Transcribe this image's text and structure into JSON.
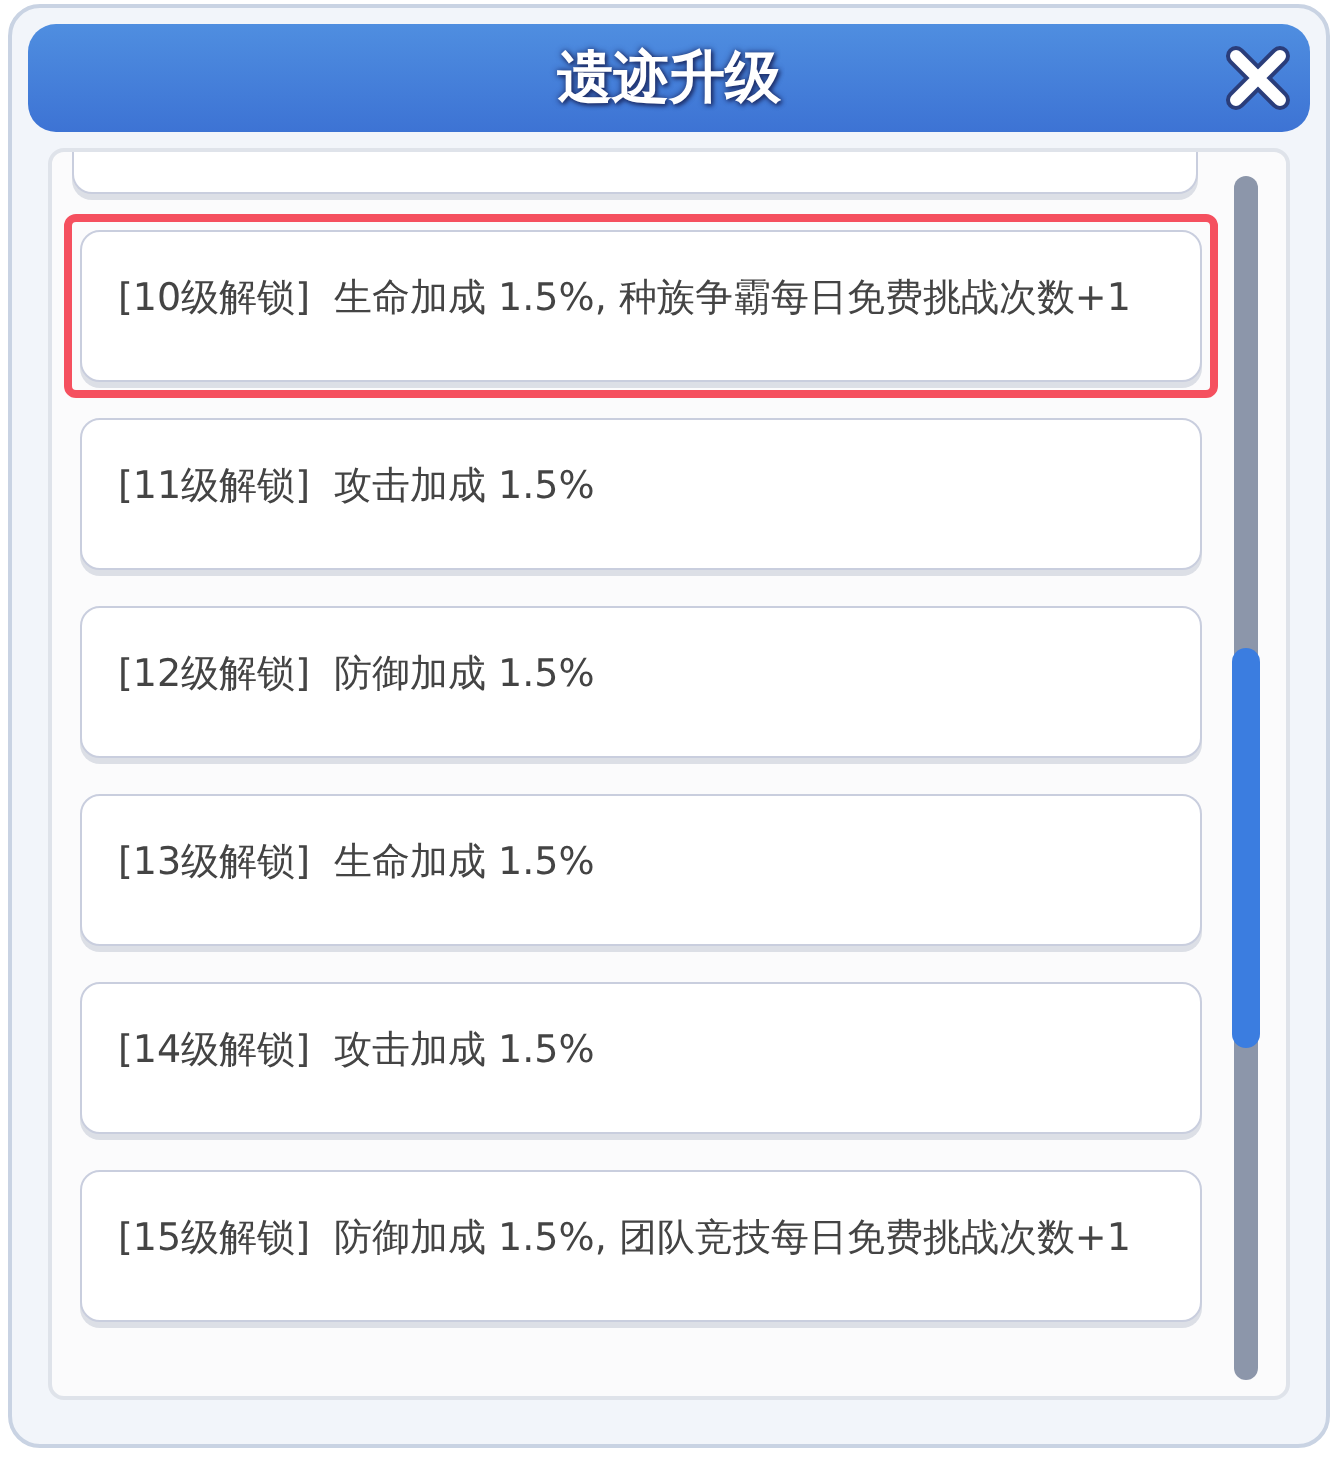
{
  "window": {
    "title": "遗迹升级"
  },
  "items": [
    {
      "tag": "[10级解锁]",
      "text": "生命加成 1.5%, 种族争霸每日免费挑战次数+1",
      "selected": true
    },
    {
      "tag": "[11级解锁]",
      "text": "攻击加成 1.5%",
      "selected": false
    },
    {
      "tag": "[12级解锁]",
      "text": "防御加成 1.5%",
      "selected": false
    },
    {
      "tag": "[13级解锁]",
      "text": "生命加成 1.5%",
      "selected": false
    },
    {
      "tag": "[14级解锁]",
      "text": "攻击加成 1.5%",
      "selected": false
    },
    {
      "tag": "[15级解锁]",
      "text": "防御加成 1.5%, 团队竞技每日免费挑战次数+1",
      "selected": false
    }
  ]
}
